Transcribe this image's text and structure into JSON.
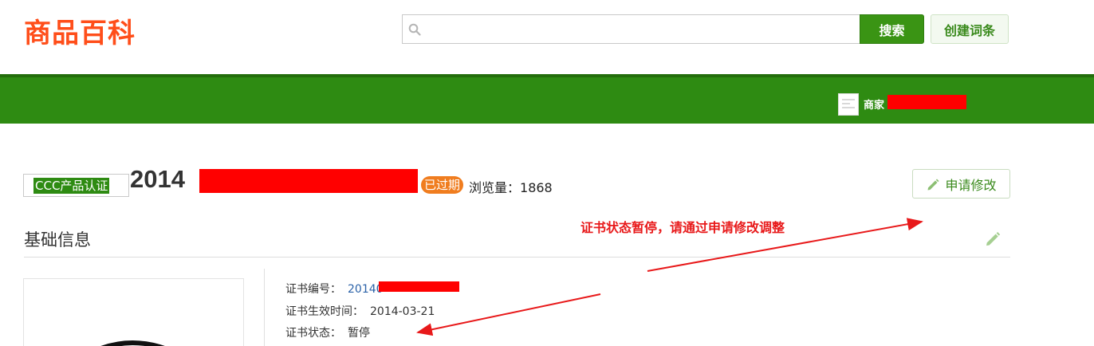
{
  "header": {
    "logo": "商品百科",
    "search": {
      "value": "",
      "placeholder": ""
    },
    "search_button": "搜索",
    "create_button": "创建词条"
  },
  "nav": {
    "merchant_label": "商家"
  },
  "product": {
    "category_tag": "CCC产品认证",
    "title_prefix": "2014",
    "status_badge": "已过期",
    "views_label": "浏览量：",
    "views_count": "1868",
    "edit_request_button": "申请修改"
  },
  "annotation": {
    "text": "证书状态暂停，请通过申请修改调整",
    "color": "#e8191a"
  },
  "section": {
    "title": "基础信息"
  },
  "details": {
    "rows": [
      {
        "label": "证书编号：",
        "value": "20140"
      },
      {
        "label": "证书生效时间：",
        "value": "2014-03-21"
      },
      {
        "label": "证书状态：",
        "value": "暂停"
      }
    ]
  },
  "colors": {
    "brand_orange": "#ff4e1a",
    "nav_green": "#2e8b12",
    "expired_orange": "#f07d1f",
    "redaction_red": "#ff0000"
  },
  "icons": [
    "search-icon",
    "pencil-icon",
    "avatar-icon"
  ]
}
